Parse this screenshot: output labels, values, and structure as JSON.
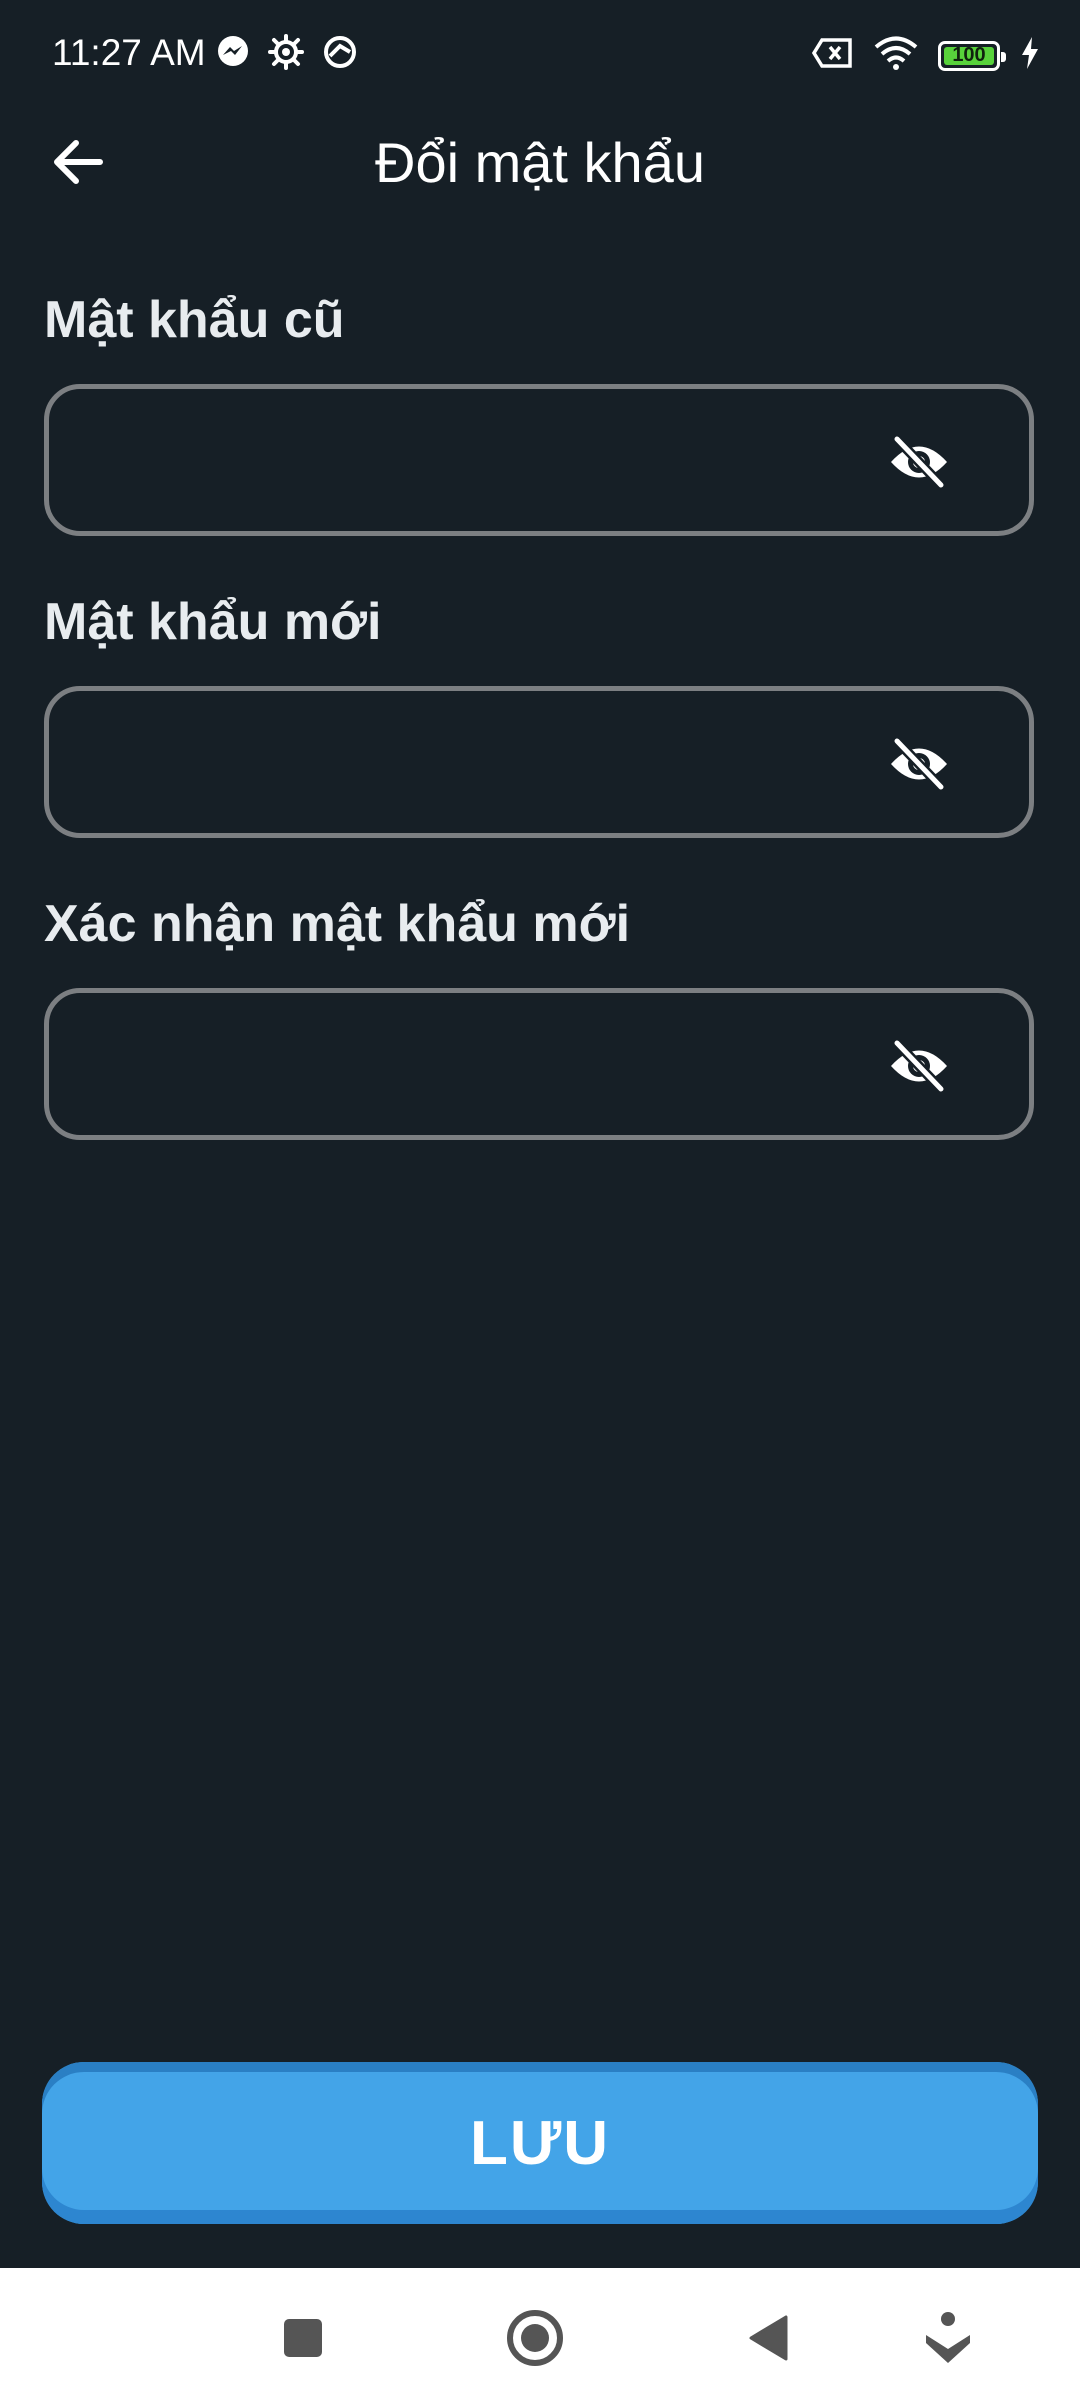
{
  "status_bar": {
    "time": "11:27 AM",
    "left_icons": [
      "messenger-icon",
      "settings-gear-icon",
      "vpn-icon"
    ],
    "right_icons": [
      "sim-blocked-icon",
      "wifi-icon",
      "battery-icon",
      "charging-icon"
    ],
    "battery_level": "100"
  },
  "app_bar": {
    "title": "Đổi mật khẩu",
    "back_icon": "arrow-left-icon"
  },
  "form": {
    "old_password": {
      "label": "Mật khẩu cũ",
      "value": "",
      "toggle_icon": "eye-off-icon"
    },
    "new_password": {
      "label": "Mật khẩu mới",
      "value": "",
      "toggle_icon": "eye-off-icon"
    },
    "confirm_password": {
      "label": "Xác nhận mật khẩu mới",
      "value": "",
      "toggle_icon": "eye-off-icon"
    }
  },
  "actions": {
    "save_label": "LƯU"
  },
  "nav_bar": {
    "items": [
      "recents-square-icon",
      "home-circle-icon",
      "back-triangle-icon",
      "assistant-icon"
    ]
  },
  "colors": {
    "background": "#161f26",
    "field_border": "#7c7f82",
    "primary_button": "#43a4e8",
    "battery_fill": "#58d23b"
  }
}
